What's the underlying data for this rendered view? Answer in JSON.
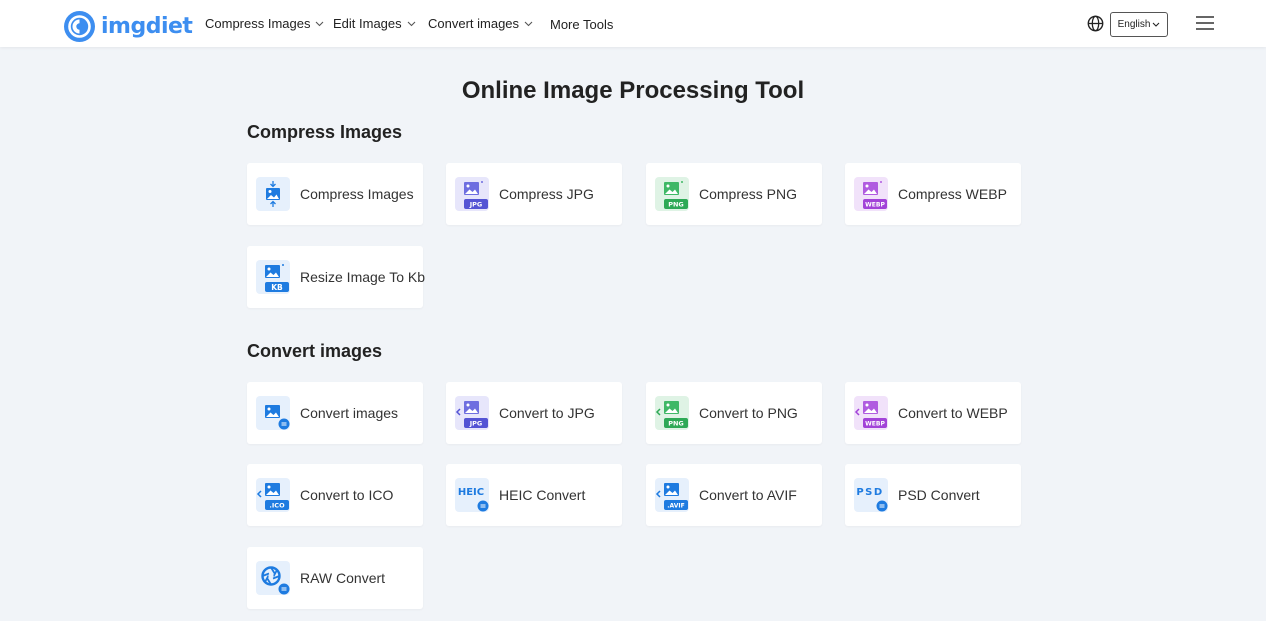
{
  "header": {
    "logo_text": "imgdiet",
    "nav": [
      {
        "label": "Compress Images",
        "has_dropdown": true
      },
      {
        "label": "Edit Images",
        "has_dropdown": true
      },
      {
        "label": "Convert images",
        "has_dropdown": true
      },
      {
        "label": "More Tools",
        "has_dropdown": false
      }
    ],
    "language": "English",
    "icons": [
      "globe-icon",
      "hamburger-menu-icon"
    ]
  },
  "colors": {
    "brand": "#3d8ef0",
    "background": "#f1f4f8",
    "jpg": "#6e6ee0",
    "png": "#3fb866",
    "webp": "#b05be0",
    "blue": "#1e7be0"
  },
  "main": {
    "title": "Online Image Processing Tool",
    "sections": [
      {
        "title": "Compress Images",
        "tools": [
          {
            "label": "Compress Images",
            "icon": "compress-image-icon"
          },
          {
            "label": "Compress JPG",
            "icon": "jpg-file-icon",
            "badge": "JPG"
          },
          {
            "label": "Compress PNG",
            "icon": "png-file-icon",
            "badge": "PNG"
          },
          {
            "label": "Compress WEBP",
            "icon": "webp-file-icon",
            "badge": "WEBP"
          },
          {
            "label": "Resize Image To Kb",
            "icon": "kb-file-icon",
            "badge": "KB"
          }
        ]
      },
      {
        "title": "Convert images",
        "tools": [
          {
            "label": "Convert images",
            "icon": "convert-image-icon"
          },
          {
            "label": "Convert to JPG",
            "icon": "convert-jpg-icon",
            "badge": "JPG"
          },
          {
            "label": "Convert to PNG",
            "icon": "convert-png-icon",
            "badge": "PNG"
          },
          {
            "label": "Convert to WEBP",
            "icon": "convert-webp-icon",
            "badge": "WEBP"
          },
          {
            "label": "Convert to ICO",
            "icon": "convert-ico-icon",
            "badge": ".ICO"
          },
          {
            "label": "HEIC Convert",
            "icon": "heic-icon",
            "badge": "HEIC"
          },
          {
            "label": "Convert to AVIF",
            "icon": "convert-avif-icon",
            "badge": ".AVIF"
          },
          {
            "label": "PSD Convert",
            "icon": "psd-icon",
            "badge": "PSD"
          },
          {
            "label": "RAW Convert",
            "icon": "raw-aperture-icon"
          }
        ]
      }
    ]
  }
}
